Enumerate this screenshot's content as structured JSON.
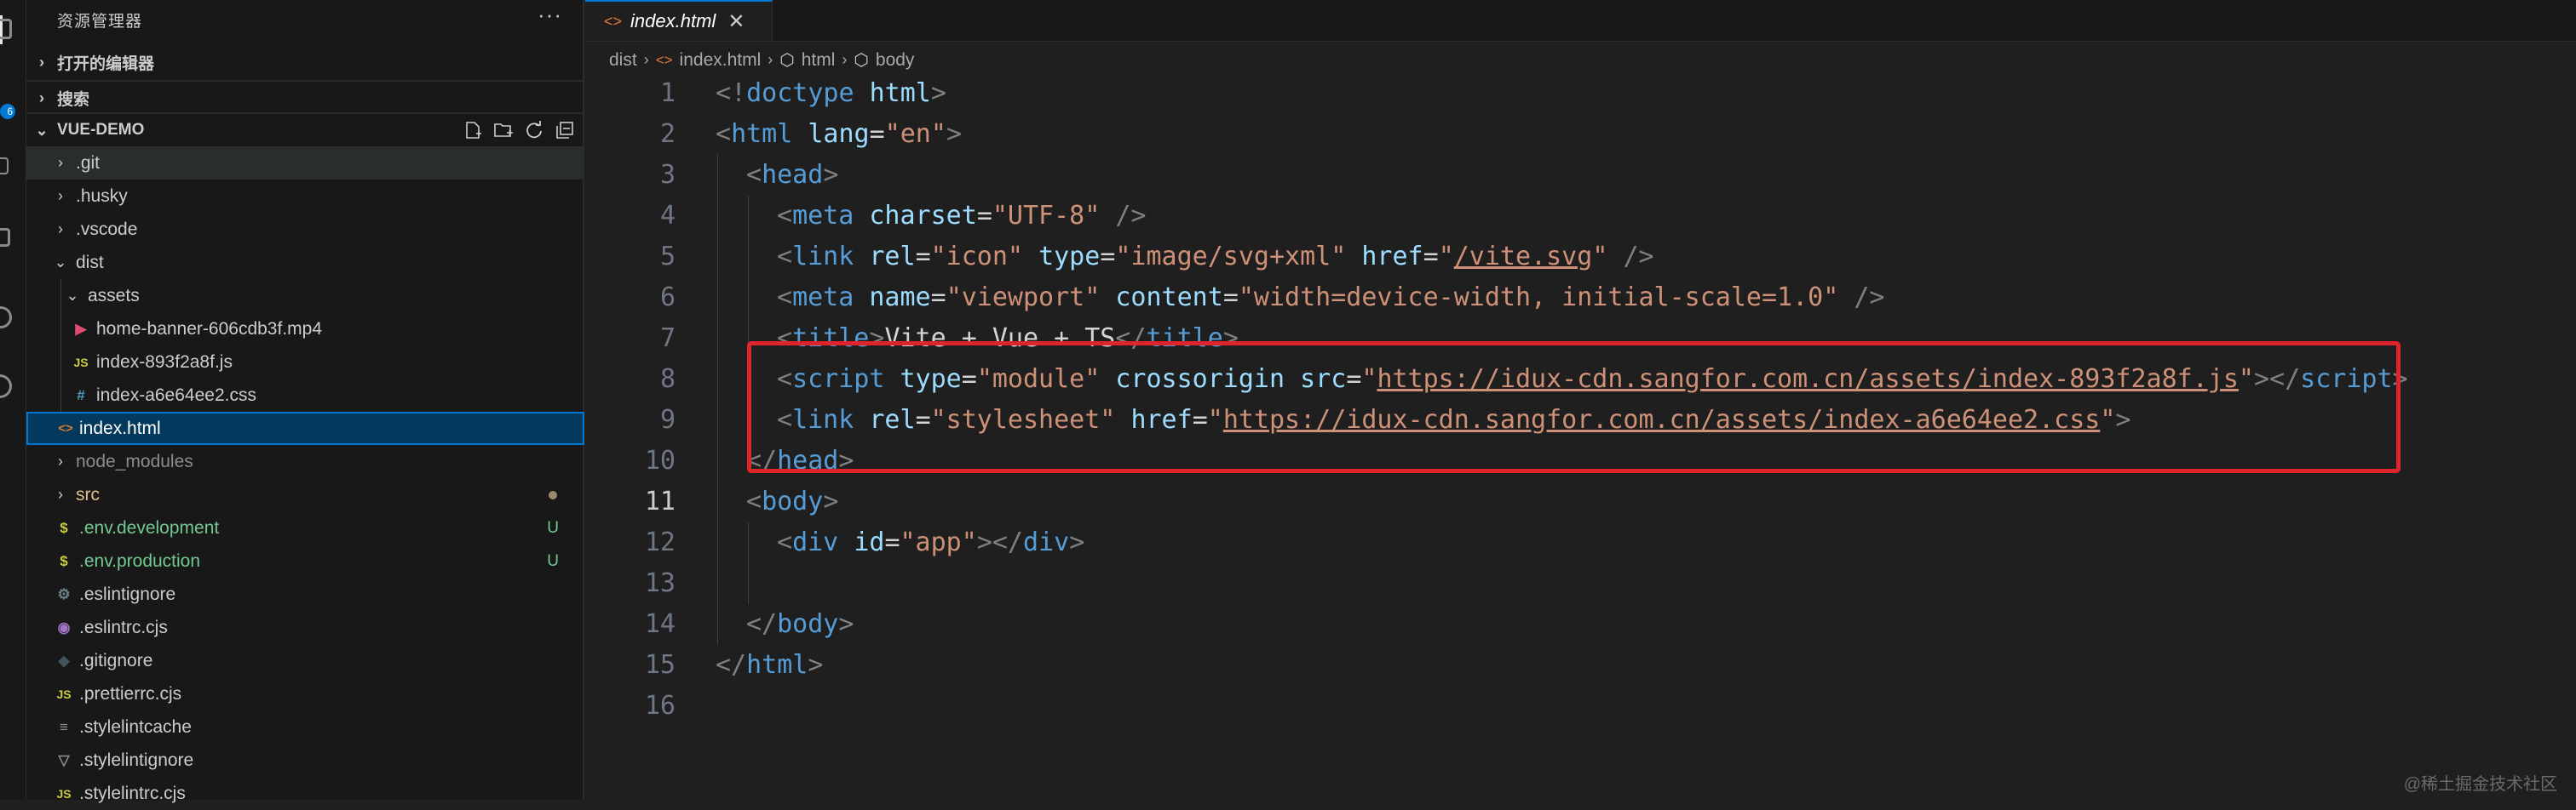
{
  "activity_bar": {
    "badge": "6"
  },
  "sidebar": {
    "title": "资源管理器",
    "more": "···",
    "sections": {
      "open_editors": "打开的编辑器",
      "search": "搜索",
      "project": "VUE-DEMO"
    },
    "files": [
      {
        "name": ".git",
        "type": "folder",
        "depth": 0
      },
      {
        "name": ".husky",
        "type": "folder",
        "depth": 0
      },
      {
        "name": ".vscode",
        "type": "folder",
        "depth": 0
      },
      {
        "name": "dist",
        "type": "folder-open",
        "depth": 0
      },
      {
        "name": "assets",
        "type": "folder-open",
        "depth": 1
      },
      {
        "name": "home-banner-606cdb3f.mp4",
        "type": "video",
        "depth": 2
      },
      {
        "name": "index-893f2a8f.js",
        "type": "js",
        "depth": 2
      },
      {
        "name": "index-a6e64ee2.css",
        "type": "css",
        "depth": 2
      },
      {
        "name": "index.html",
        "type": "html",
        "depth": 1
      },
      {
        "name": "node_modules",
        "type": "folder",
        "depth": 0
      },
      {
        "name": "src",
        "type": "folder",
        "depth": 0
      },
      {
        "name": ".env.development",
        "type": "env",
        "depth": 0,
        "status": "U"
      },
      {
        "name": ".env.production",
        "type": "env",
        "depth": 0,
        "status": "U"
      },
      {
        "name": ".eslintignore",
        "type": "gear",
        "depth": 0
      },
      {
        "name": ".eslintrc.cjs",
        "type": "eslint",
        "depth": 0
      },
      {
        "name": ".gitignore",
        "type": "git",
        "depth": 0
      },
      {
        "name": ".prettierrc.cjs",
        "type": "js",
        "depth": 0
      },
      {
        "name": ".stylelintcache",
        "type": "lines",
        "depth": 0
      },
      {
        "name": ".stylelintignore",
        "type": "stylelint",
        "depth": 0
      },
      {
        "name": ".stylelintrc.cjs",
        "type": "js",
        "depth": 0
      }
    ]
  },
  "editor": {
    "tab": {
      "label": "index.html",
      "close": "✕"
    },
    "breadcrumb": [
      "dist",
      "index.html",
      "html",
      "body"
    ],
    "lines": [
      {
        "n": "1",
        "indent": 0,
        "tokens": [
          [
            "t",
            "<!"
          ],
          [
            "tag",
            "doctype"
          ],
          [
            "plain",
            " "
          ],
          [
            "attr",
            "html"
          ],
          [
            "t",
            ">"
          ]
        ]
      },
      {
        "n": "2",
        "indent": 0,
        "tokens": [
          [
            "t",
            "<"
          ],
          [
            "tag",
            "html"
          ],
          [
            "plain",
            " "
          ],
          [
            "attr",
            "lang"
          ],
          [
            "plain",
            "="
          ],
          [
            "val",
            "\"en\""
          ],
          [
            "t",
            ">"
          ]
        ]
      },
      {
        "n": "3",
        "indent": 1,
        "tokens": [
          [
            "t",
            "<"
          ],
          [
            "tag",
            "head"
          ],
          [
            "t",
            ">"
          ]
        ]
      },
      {
        "n": "4",
        "indent": 2,
        "tokens": [
          [
            "t",
            "<"
          ],
          [
            "tag",
            "meta"
          ],
          [
            "plain",
            " "
          ],
          [
            "attr",
            "charset"
          ],
          [
            "plain",
            "="
          ],
          [
            "val",
            "\"UTF-8\""
          ],
          [
            "plain",
            " "
          ],
          [
            "t",
            "/>"
          ]
        ]
      },
      {
        "n": "5",
        "indent": 2,
        "tokens": [
          [
            "t",
            "<"
          ],
          [
            "tag",
            "link"
          ],
          [
            "plain",
            " "
          ],
          [
            "attr",
            "rel"
          ],
          [
            "plain",
            "="
          ],
          [
            "val",
            "\"icon\""
          ],
          [
            "plain",
            " "
          ],
          [
            "attr",
            "type"
          ],
          [
            "plain",
            "="
          ],
          [
            "val",
            "\"image/svg+xml\""
          ],
          [
            "plain",
            " "
          ],
          [
            "attr",
            "href"
          ],
          [
            "plain",
            "="
          ],
          [
            "val",
            "\""
          ],
          [
            "url",
            "/vite.svg"
          ],
          [
            "val",
            "\""
          ],
          [
            "plain",
            " "
          ],
          [
            "t",
            "/>"
          ]
        ]
      },
      {
        "n": "6",
        "indent": 2,
        "tokens": [
          [
            "t",
            "<"
          ],
          [
            "tag",
            "meta"
          ],
          [
            "plain",
            " "
          ],
          [
            "attr",
            "name"
          ],
          [
            "plain",
            "="
          ],
          [
            "val",
            "\"viewport\""
          ],
          [
            "plain",
            " "
          ],
          [
            "attr",
            "content"
          ],
          [
            "plain",
            "="
          ],
          [
            "val",
            "\"width=device-width, initial-scale=1.0\""
          ],
          [
            "plain",
            " "
          ],
          [
            "t",
            "/>"
          ]
        ]
      },
      {
        "n": "7",
        "indent": 2,
        "tokens": [
          [
            "t",
            "<"
          ],
          [
            "tag",
            "title"
          ],
          [
            "t",
            ">"
          ],
          [
            "plain",
            "Vite + Vue + TS"
          ],
          [
            "t",
            "</"
          ],
          [
            "tag",
            "title"
          ],
          [
            "t",
            ">"
          ]
        ]
      },
      {
        "n": "8",
        "indent": 2,
        "tokens": [
          [
            "t",
            "<"
          ],
          [
            "tag",
            "script"
          ],
          [
            "plain",
            " "
          ],
          [
            "attr",
            "type"
          ],
          [
            "plain",
            "="
          ],
          [
            "val",
            "\"module\""
          ],
          [
            "plain",
            " "
          ],
          [
            "attr",
            "crossorigin"
          ],
          [
            "plain",
            " "
          ],
          [
            "attr",
            "src"
          ],
          [
            "plain",
            "="
          ],
          [
            "val",
            "\""
          ],
          [
            "url",
            "https://idux-cdn.sangfor.com.cn/assets/index-893f2a8f.js"
          ],
          [
            "val",
            "\""
          ],
          [
            "t",
            "></"
          ],
          [
            "tag",
            "script"
          ],
          [
            "t",
            ">"
          ]
        ]
      },
      {
        "n": "9",
        "indent": 2,
        "tokens": [
          [
            "t",
            "<"
          ],
          [
            "tag",
            "link"
          ],
          [
            "plain",
            " "
          ],
          [
            "attr",
            "rel"
          ],
          [
            "plain",
            "="
          ],
          [
            "val",
            "\"stylesheet\""
          ],
          [
            "plain",
            " "
          ],
          [
            "attr",
            "href"
          ],
          [
            "plain",
            "="
          ],
          [
            "val",
            "\""
          ],
          [
            "url",
            "https://idux-cdn.sangfor.com.cn/assets/index-a6e64ee2.css"
          ],
          [
            "val",
            "\""
          ],
          [
            "t",
            ">"
          ]
        ]
      },
      {
        "n": "10",
        "indent": 1,
        "tokens": [
          [
            "t",
            "</"
          ],
          [
            "tag",
            "head"
          ],
          [
            "t",
            ">"
          ]
        ]
      },
      {
        "n": "11",
        "indent": 1,
        "current": true,
        "tokens": [
          [
            "t",
            "<"
          ],
          [
            "tag",
            "body"
          ],
          [
            "t",
            ">"
          ]
        ]
      },
      {
        "n": "12",
        "indent": 2,
        "tokens": [
          [
            "t",
            "<"
          ],
          [
            "tag",
            "div"
          ],
          [
            "plain",
            " "
          ],
          [
            "attr",
            "id"
          ],
          [
            "plain",
            "="
          ],
          [
            "val",
            "\"app\""
          ],
          [
            "t",
            "></"
          ],
          [
            "tag",
            "div"
          ],
          [
            "t",
            ">"
          ]
        ]
      },
      {
        "n": "13",
        "indent": 2,
        "tokens": []
      },
      {
        "n": "14",
        "indent": 1,
        "tokens": [
          [
            "t",
            "</"
          ],
          [
            "tag",
            "body"
          ],
          [
            "t",
            ">"
          ]
        ]
      },
      {
        "n": "15",
        "indent": 0,
        "tokens": [
          [
            "t",
            "</"
          ],
          [
            "tag",
            "html"
          ],
          [
            "t",
            ">"
          ]
        ]
      },
      {
        "n": "16",
        "indent": 0,
        "tokens": []
      }
    ]
  },
  "watermark": "@稀土掘金技术社区"
}
